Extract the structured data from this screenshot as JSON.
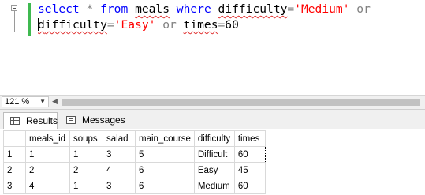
{
  "editor": {
    "line1": {
      "kw_select": "select",
      "op_star": "*",
      "kw_from": "from",
      "table": "meals",
      "kw_where": "where",
      "col1": "difficulty",
      "eq1": "=",
      "val1": "'Medium'",
      "op_or": "or"
    },
    "line2": {
      "col2a": "d",
      "col2b": "ifficulty",
      "eq2": "=",
      "val2": "'Easy'",
      "op_or": "or",
      "col3": "times",
      "eq3": "=",
      "val3": "60"
    }
  },
  "zoom": {
    "level": "121 %",
    "dropdown_icon": "chevron-down-icon",
    "scroll_left_icon": "scroll-left-icon"
  },
  "tabs": {
    "results": "Results",
    "messages": "Messages",
    "results_icon": "grid-icon",
    "messages_icon": "messages-icon"
  },
  "grid": {
    "columns": [
      "meals_id",
      "soups",
      "salad",
      "main_course",
      "difficulty",
      "times"
    ],
    "rows": [
      {
        "num": "1",
        "cells": [
          "1",
          "1",
          "3",
          "5",
          "Difficult",
          "60"
        ]
      },
      {
        "num": "2",
        "cells": [
          "2",
          "2",
          "4",
          "6",
          "Easy",
          "45"
        ]
      },
      {
        "num": "3",
        "cells": [
          "4",
          "1",
          "3",
          "6",
          "Medium",
          "60"
        ]
      }
    ]
  },
  "colors": {
    "keyword": "#0000ff",
    "string": "#ff0000",
    "operator": "#808080",
    "change_bar": "#3fb950"
  }
}
